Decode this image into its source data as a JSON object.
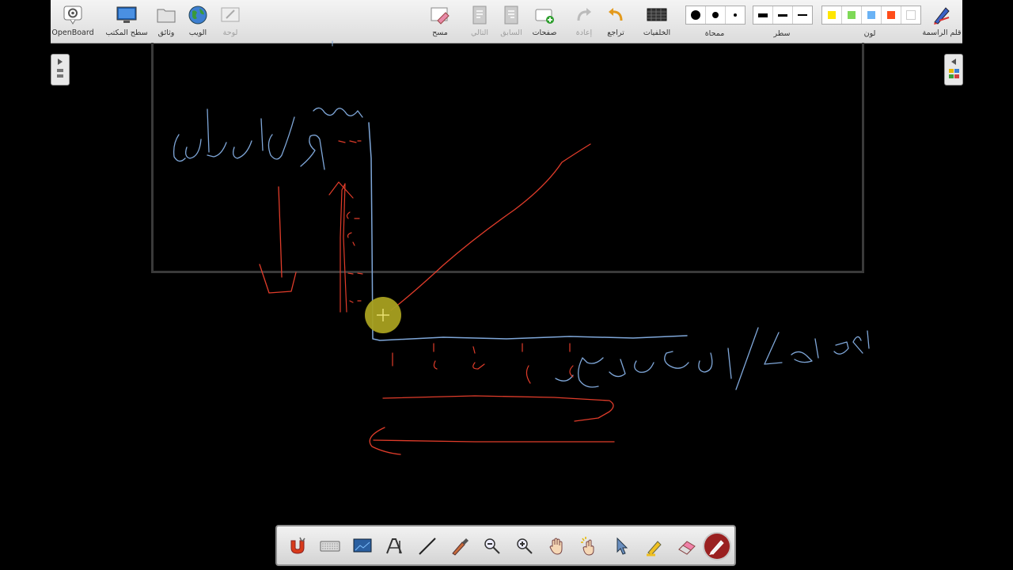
{
  "toolbar": {
    "openboard": "OpenBoard",
    "desktop": "سطح المكتب",
    "documents": "وثائق",
    "web": "الويب",
    "board": "لوحة",
    "erase": "مسح",
    "next": "التالي",
    "previous": "السابق",
    "pages": "صفحات",
    "redo": "إعادة",
    "undo": "تراجع",
    "backgrounds": "الخلفيات",
    "eraser_size": "ممحاة",
    "line_width": "سطر",
    "color": "لون",
    "pen_tool": "قلم الراسمة"
  },
  "colors": {
    "yellow": "#ffe600",
    "green": "#7ed957",
    "blue": "#6ab3f5",
    "red": "#ff4d1a",
    "white": "#ffffff",
    "ink_blue": "#7fa7d9",
    "ink_red": "#e03c2a"
  },
  "bottom_tools": [
    "magnet-icon",
    "keyboard-icon",
    "screen-icon",
    "text-icon",
    "line-icon",
    "marker-icon",
    "zoom-out-icon",
    "zoom-in-icon",
    "hand-icon",
    "laser-icon",
    "pointer-icon",
    "highlighter-icon",
    "eraser-icon",
    "pen-icon"
  ]
}
